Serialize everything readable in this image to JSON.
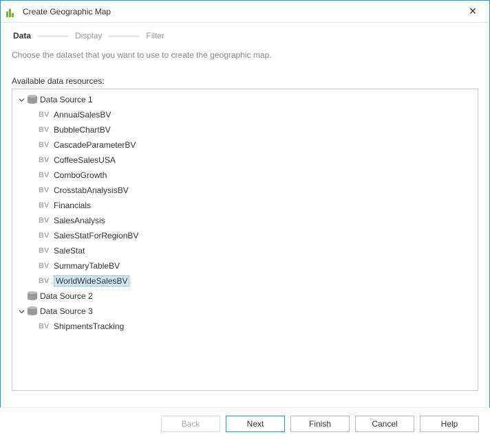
{
  "window": {
    "title": "Create Geographic Map"
  },
  "steps": {
    "data": "Data",
    "display": "Display",
    "filter": "Filter"
  },
  "description": "Choose the dataset that you want to use to create the geographic map.",
  "resources_label": "Available data resources:",
  "tree": {
    "ds1": {
      "label": "Data Source 1",
      "expanded": true,
      "items": [
        "AnnualSalesBV",
        "BubbleChartBV",
        "CascadeParameterBV",
        "CoffeeSalesUSA",
        "ComboGrowth",
        "CrosstabAnalysisBV",
        "Financials",
        "SalesAnalysis",
        "SalesStatForRegionBV",
        "SaleStat",
        "SummaryTableBV",
        "WorldWideSalesBV"
      ],
      "selected": "WorldWideSalesBV"
    },
    "ds2": {
      "label": "Data Source 2",
      "expanded": false
    },
    "ds3": {
      "label": "Data Source 3",
      "expanded": true,
      "items": [
        "ShipmentsTracking"
      ]
    }
  },
  "icons": {
    "bv": "BV"
  },
  "buttons": {
    "back": "Back",
    "next": "Next",
    "finish": "Finish",
    "cancel": "Cancel",
    "help": "Help"
  }
}
